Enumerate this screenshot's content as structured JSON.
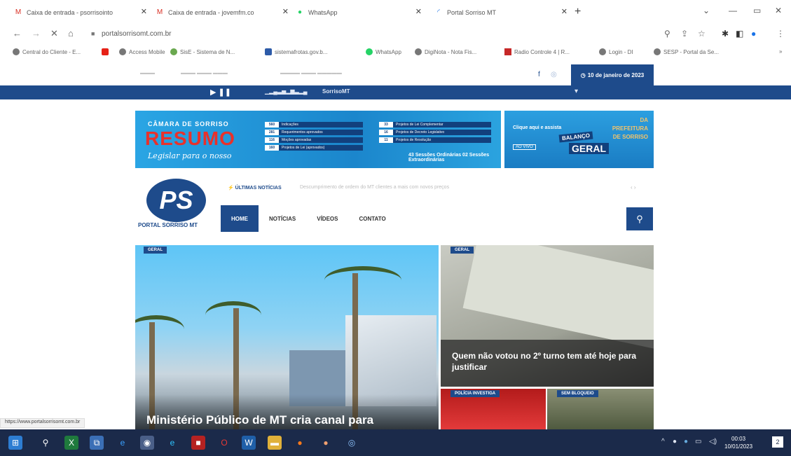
{
  "browser": {
    "tabs": [
      {
        "label": "Caixa de entrada - psorrisointo",
        "icon": "gmail-icon",
        "color": "#d93025"
      },
      {
        "label": "Caixa de entrada - jovemfm.co",
        "icon": "gmail-icon",
        "color": "#d93025"
      },
      {
        "label": "WhatsApp",
        "icon": "whatsapp-icon",
        "color": "#25d366"
      },
      {
        "label": "Portal Sorriso MT",
        "icon": "loading-icon",
        "color": "#1a73e8"
      }
    ],
    "new_tab": "+",
    "window": {
      "minimize": "—",
      "maximize": "▭",
      "close": "✕"
    },
    "url": "portalsorrisomt.com.br",
    "bookmarks": [
      "Central do Cliente - E...",
      "",
      "Access Mobile",
      "SisE - Sistema de N...",
      "sistemafrotas.gov.b...",
      "WhatsApp",
      "DigiNota - Nota Fis...",
      "Radio Controle 4 | R...",
      "Login - DI",
      "SESP - Portal da Se..."
    ]
  },
  "site": {
    "date": "10 de janeiro de 2023",
    "radio_label": "SorrisoMT",
    "banner1": {
      "line1": "CÂMARA DE SORRISO",
      "line2": "RESUMO",
      "line3": "Legislar para o nosso",
      "stats_left": [
        {
          "n": "560",
          "t": "Indicações"
        },
        {
          "n": "281",
          "t": "Requerimentos aprovados"
        },
        {
          "n": "116",
          "t": "Moções aprovadas"
        },
        {
          "n": "160",
          "t": "Projetos de Lei (aprovados)"
        }
      ],
      "stats_right": [
        {
          "n": "33",
          "t": "Projetos de Lei Complementar"
        },
        {
          "n": "16",
          "t": "Projetos de Decreto Legislativo"
        },
        {
          "n": "11",
          "t": "Projetos de Resolução"
        }
      ],
      "sessions": "43 Sessões Ordinárias 02 Sessões Extraordinárias"
    },
    "banner2": {
      "cta": "Clique aqui e assista",
      "live": "AO VIVO",
      "balanco": "BALANÇO",
      "geral": "GERAL",
      "side": "DA PREFEITURA DE SORRISO"
    },
    "logo": {
      "initials": "PS",
      "name": "PORTAL SORRISO MT"
    },
    "ultimas_label": "ÚLTIMAS NOTÍCIAS",
    "ultimas_text": "Descumprimento de ordem do MT clientes a mais com novos preços",
    "menu": [
      "HOME",
      "NOTÍCIAS",
      "VÍDEOS",
      "CONTATO"
    ],
    "hero": {
      "badge": "GERAL",
      "title": "Ministério Público de MT cria canal para"
    },
    "card1": {
      "badge": "GERAL",
      "title": "Quem não votou no 2º turno tem até hoje para justificar"
    },
    "card2": {
      "badge": "POLÍCIA INVESTIGA"
    },
    "card3": {
      "badge": "SEM BLOQUEIO"
    },
    "status_url": "https://www.portalsorrisomt.com.br"
  },
  "taskbar": {
    "time": "00:03",
    "date": "10/01/2023",
    "notifications": "2"
  },
  "colors": {
    "brand": "#1e4b8b",
    "taskbar": "#1b2a4a"
  }
}
